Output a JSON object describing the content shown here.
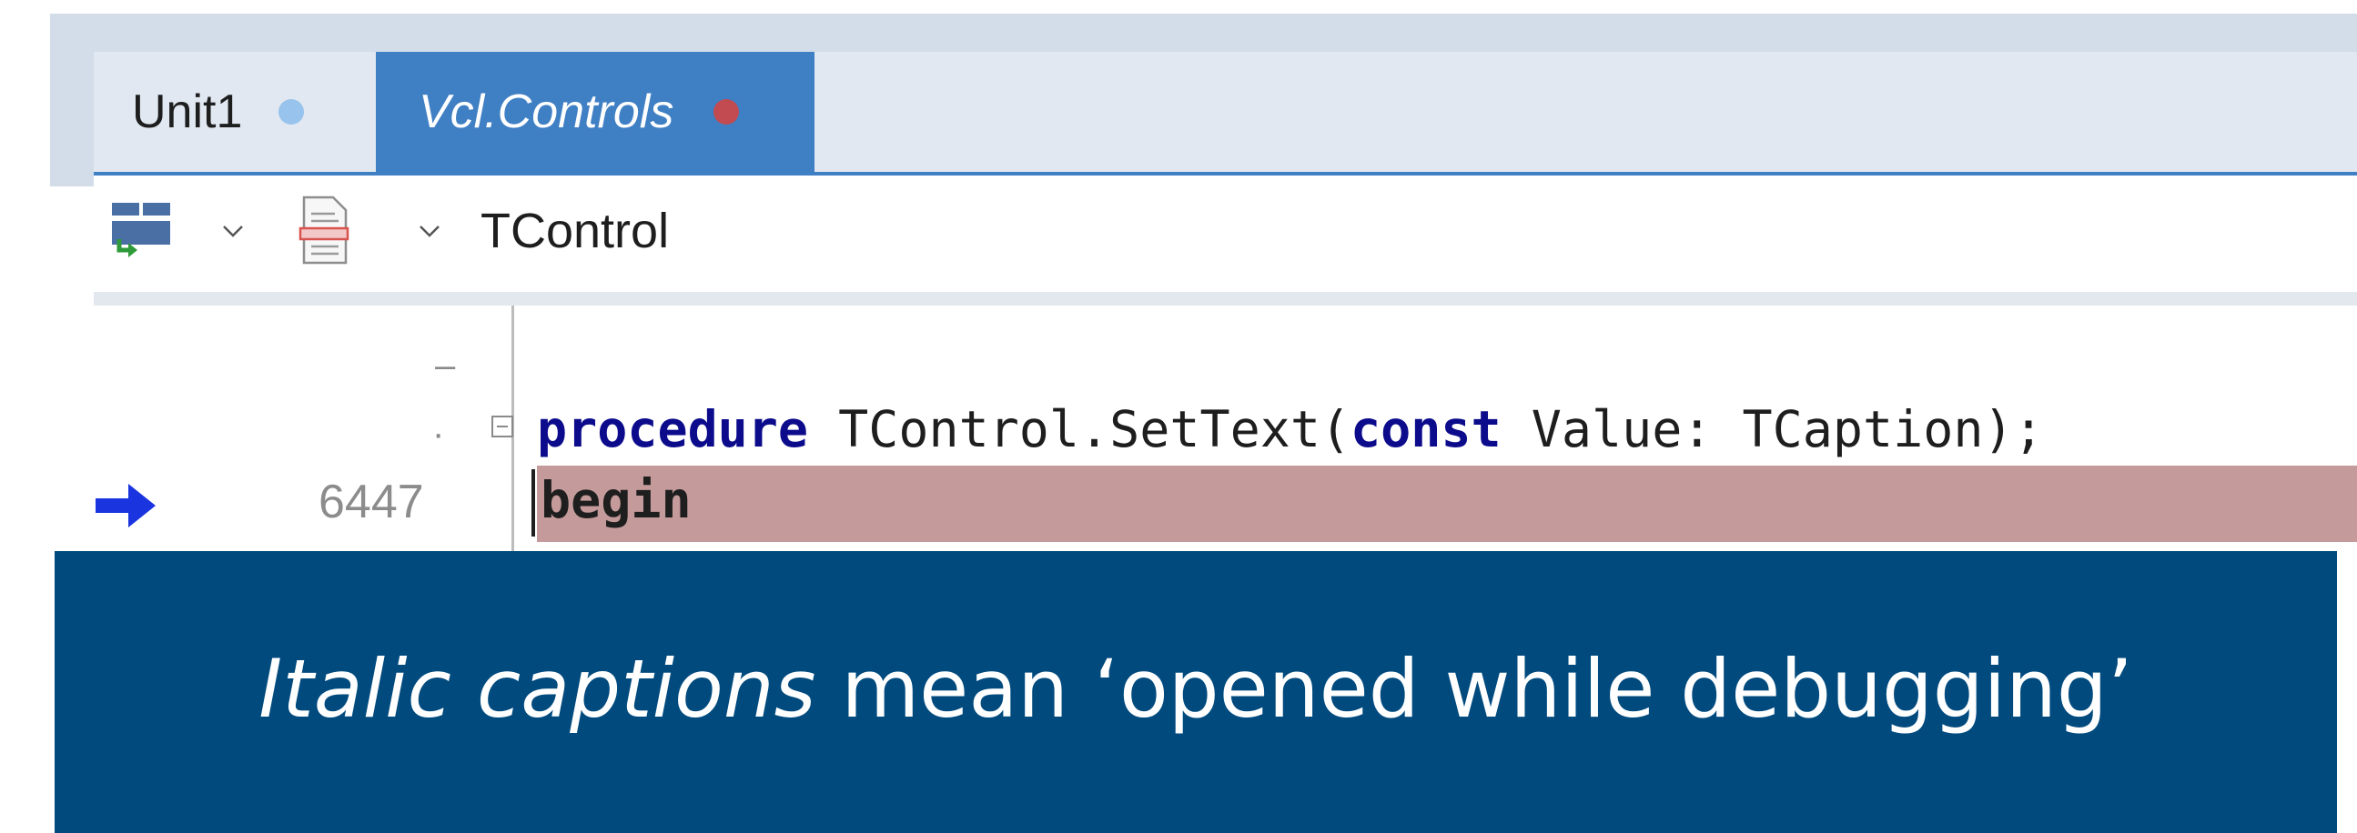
{
  "tabs": [
    {
      "label": "Unit1",
      "italic": false,
      "status_color": "#97c3ec"
    },
    {
      "label": "Vcl.Controls",
      "italic": true,
      "active": true,
      "status_color": "#c14b51"
    }
  ],
  "toolbar": {
    "class_selector_icon": "structure-view-icon",
    "unit_selector_icon": "document-icon",
    "current_symbol": "TControl"
  },
  "editor": {
    "code_line_1": {
      "kw_procedure": "procedure",
      "text_a": " TControl.SetText(",
      "kw_const": "const",
      "text_b": " Value: TCaption);"
    },
    "code_line_2": {
      "kw_begin": "begin",
      "line_number": "6447"
    },
    "execution_point_icon": "execution-arrow-icon",
    "highlight_color": "#c49a9a"
  },
  "caption": {
    "italic_part": "Italic captions",
    "rest": " mean ‘opened while debugging’"
  },
  "colors": {
    "accent": "#3f7fc4",
    "banner": "#004a7e"
  }
}
